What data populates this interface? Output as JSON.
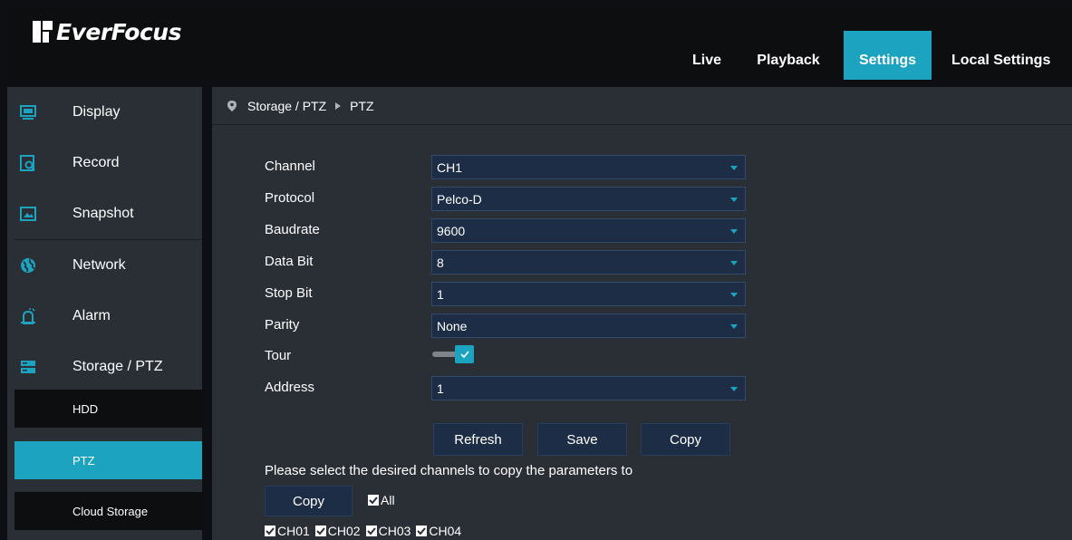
{
  "brand": {
    "name": "EverFocus"
  },
  "nav": {
    "tabs": [
      {
        "label": "Live"
      },
      {
        "label": "Playback"
      },
      {
        "label": "Settings",
        "active": true
      },
      {
        "label": "Local Settings"
      }
    ]
  },
  "sidebar": {
    "items": [
      {
        "label": "Display",
        "icon": "monitor-icon"
      },
      {
        "label": "Record",
        "icon": "record-search-icon"
      },
      {
        "label": "Snapshot",
        "icon": "snapshot-icon"
      },
      {
        "label": "Network",
        "icon": "network-globe-icon"
      },
      {
        "label": "Alarm",
        "icon": "alarm-icon"
      },
      {
        "label": "Storage / PTZ",
        "icon": "storage-icon"
      }
    ],
    "subitems": [
      {
        "label": "HDD"
      },
      {
        "label": "PTZ",
        "active": true
      },
      {
        "label": "Cloud Storage"
      }
    ]
  },
  "breadcrumb": {
    "section": "Storage / PTZ",
    "page": "PTZ"
  },
  "form": {
    "channel": {
      "label": "Channel",
      "value": "CH1"
    },
    "protocol": {
      "label": "Protocol",
      "value": "Pelco-D"
    },
    "baudrate": {
      "label": "Baudrate",
      "value": "9600"
    },
    "data_bit": {
      "label": "Data Bit",
      "value": "8"
    },
    "stop_bit": {
      "label": "Stop Bit",
      "value": "1"
    },
    "parity": {
      "label": "Parity",
      "value": "None"
    },
    "tour": {
      "label": "Tour",
      "enabled": true
    },
    "address": {
      "label": "Address",
      "value": "1"
    }
  },
  "actions": {
    "refresh": "Refresh",
    "save": "Save",
    "copy": "Copy"
  },
  "copy_panel": {
    "instruction": "Please select the desired channels to copy the parameters to",
    "copy_button": "Copy",
    "all_label": "All",
    "channels": [
      "CH01",
      "CH02",
      "CH03",
      "CH04"
    ]
  },
  "colors": {
    "accent": "#1ba3bf",
    "panel": "#2a2e35",
    "field": "#1c2d45",
    "topbar": "#0d0e10"
  }
}
